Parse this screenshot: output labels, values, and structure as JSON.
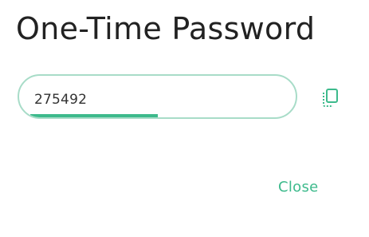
{
  "dialog": {
    "title": "One-Time Password",
    "otp": {
      "value": "275492",
      "time_remaining_fraction": 0.5
    },
    "copy_icon": "copy-icon",
    "close_label": "Close",
    "colors": {
      "accent": "#3dba8c",
      "field_border": "#a8dcc8",
      "title_text": "#222222"
    }
  }
}
